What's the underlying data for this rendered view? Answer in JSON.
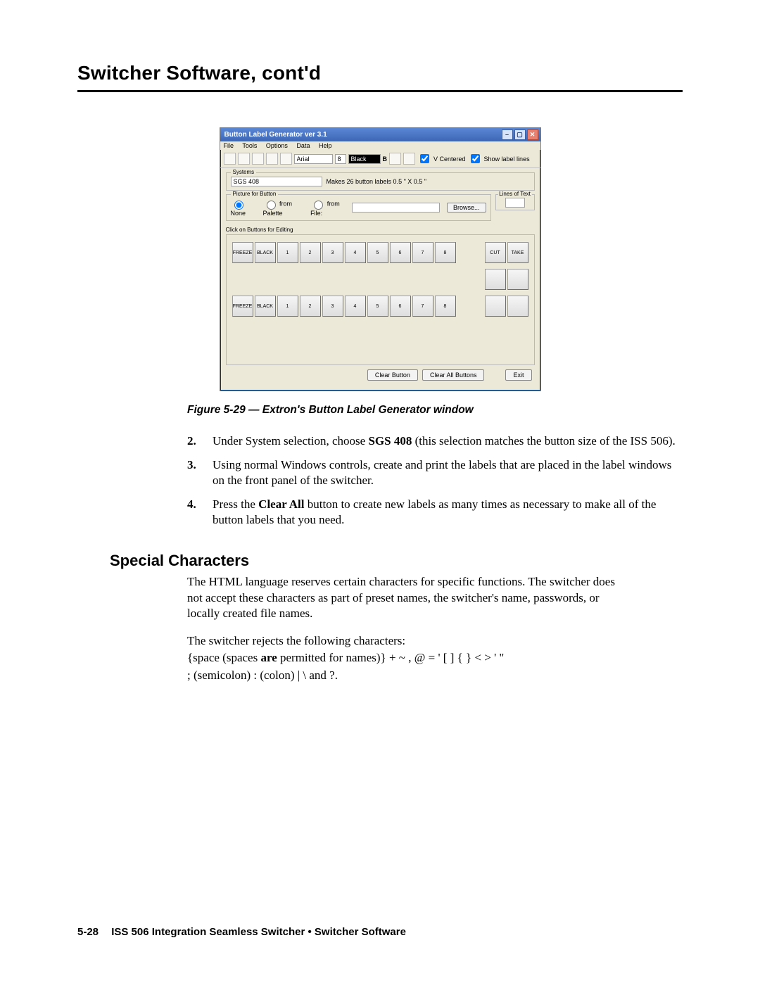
{
  "page": {
    "heading": "Switcher Software, cont'd",
    "figure_caption": "Figure 5-29 — Extron's Button Label Generator window",
    "section_heading": "Special Characters",
    "footer_pagenum": "5-28",
    "footer_text": "ISS 506 Integration Seamless Switcher • Switcher Software"
  },
  "window": {
    "title": "Button Label Generator   ver 3.1",
    "menu": {
      "file": "File",
      "tools": "Tools",
      "options": "Options",
      "data": "Data",
      "help": "Help"
    },
    "toolbar": {
      "font_name": "Arial",
      "size_value": "8",
      "color_label": "Black",
      "bold": "B",
      "vcentered_label": "V Centered",
      "showlines_label": "Show label lines"
    },
    "systems": {
      "group_label": "Systems",
      "selected": "SGS 408",
      "note": "Makes 26 button labels 0.5 \" X  0.5 \""
    },
    "picture": {
      "group_label": "Picture for Button",
      "radio_none": "None",
      "radio_palette": "from Palette",
      "radio_file": "from File:",
      "browse": "Browse..."
    },
    "lines": {
      "group_label": "Lines of Text",
      "value": ""
    },
    "click_label": "Click on Buttons for Editing",
    "buttons": {
      "freeze": "FREEZE",
      "black": "BLACK",
      "n1": "1",
      "n2": "2",
      "n3": "3",
      "n4": "4",
      "n5": "5",
      "n6": "6",
      "n7": "7",
      "n8": "8",
      "cut": "CUT",
      "take": "TAKE"
    },
    "footer": {
      "clear": "Clear Button",
      "clear_all": "Clear All Buttons",
      "exit": "Exit"
    }
  },
  "list": {
    "i2": {
      "num": "2.",
      "a": "Under System selection, choose ",
      "b_bold": "SGS 408",
      "c": " (this selection matches the button size of the ISS 506)."
    },
    "i3": {
      "num": "3.",
      "text": "Using normal Windows controls, create and print the labels that are placed in the label windows on the front panel of the switcher."
    },
    "i4": {
      "num": "4.",
      "a": "Press the ",
      "b_bold": "Clear All",
      "c": " button to create new labels as many times as necessary to make all of the button labels that you need."
    }
  },
  "special": {
    "p1": "The HTML language reserves certain characters for specific functions.  The switcher does not accept these characters as part of preset names, the switcher's name, passwords, or locally created file names.",
    "p2": "The switcher rejects the following characters:",
    "p3a": "{space (spaces ",
    "p3b_bold": "are",
    "p3c": " permitted for names)}  +  ~  ,  @  =  '  [  ]  {  }  <  >  '  \"",
    "p4": "; (semicolon)  : (colon)  |  \\  and ?."
  }
}
